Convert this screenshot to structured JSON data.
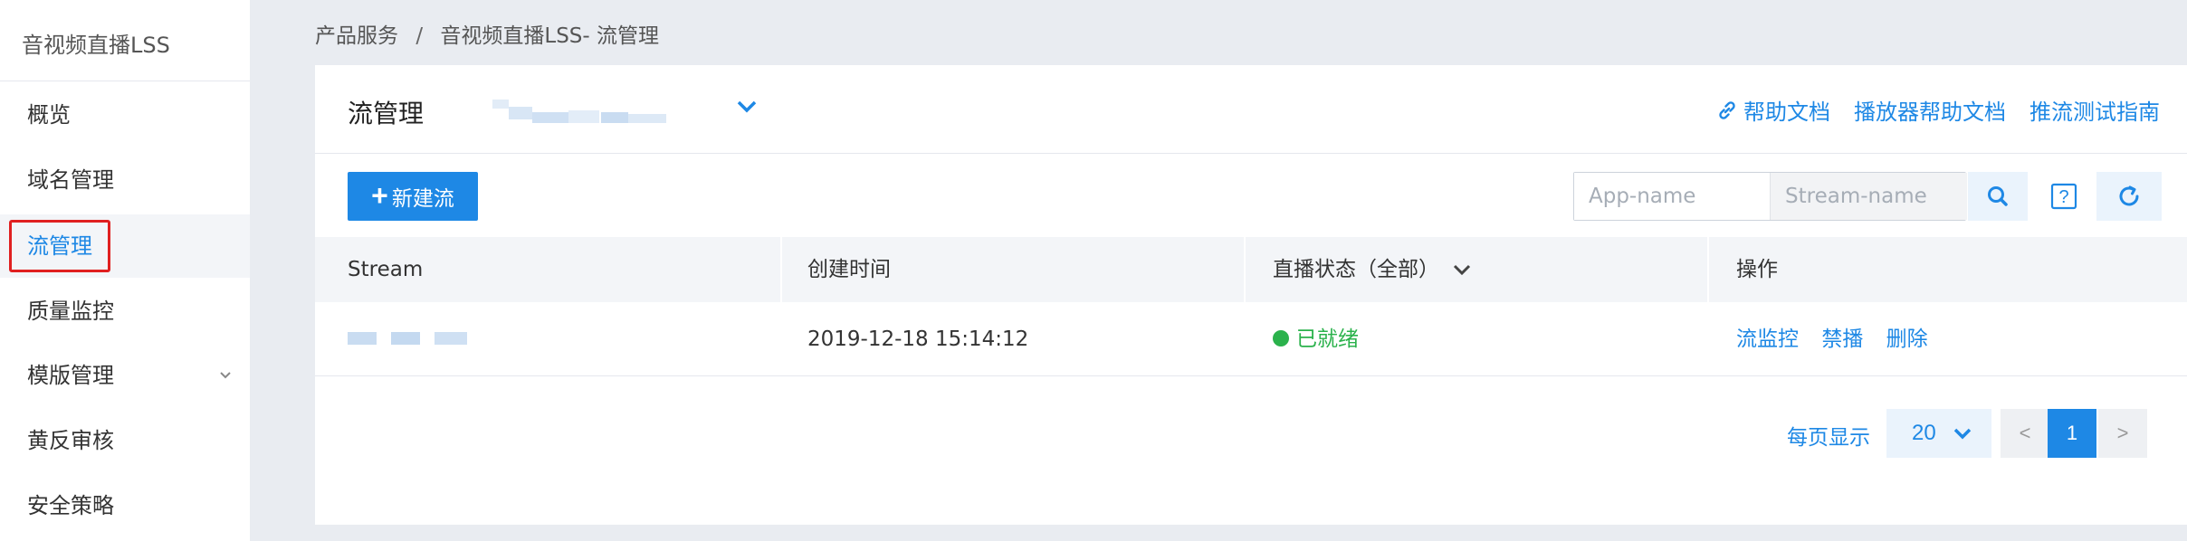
{
  "sidebar": {
    "title": "音视频直播LSS",
    "items": [
      {
        "label": "概览"
      },
      {
        "label": "域名管理"
      },
      {
        "label": "流管理"
      },
      {
        "label": "质量监控"
      },
      {
        "label": "模版管理"
      },
      {
        "label": "黄反审核"
      },
      {
        "label": "安全策略"
      }
    ]
  },
  "breadcrumb": {
    "root": "产品服务",
    "separator": "/",
    "current": "音视频直播LSS- 流管理"
  },
  "header": {
    "title": "流管理",
    "links": {
      "help": "帮助文档",
      "player_help": "播放器帮助文档",
      "push_guide": "推流测试指南"
    }
  },
  "toolbar": {
    "new_stream": "新建流",
    "app_placeholder": "App-name",
    "stream_placeholder": "Stream-name",
    "help_glyph": "?"
  },
  "table": {
    "columns": {
      "stream": "Stream",
      "created": "创建时间",
      "status": "直播状态（全部）",
      "ops": "操作"
    },
    "rows": [
      {
        "created": "2019-12-18 15:14:12",
        "status": "已就绪",
        "ops": [
          "流监控",
          "禁播",
          "删除"
        ]
      }
    ]
  },
  "pagination": {
    "label": "每页显示",
    "page_size": "20",
    "prev": "<",
    "current": "1",
    "next": ">"
  },
  "colors": {
    "accent": "#1e88e5",
    "status_ready": "#2bb24c",
    "highlight_box": "#e02020",
    "background": "#e9ecf1"
  }
}
